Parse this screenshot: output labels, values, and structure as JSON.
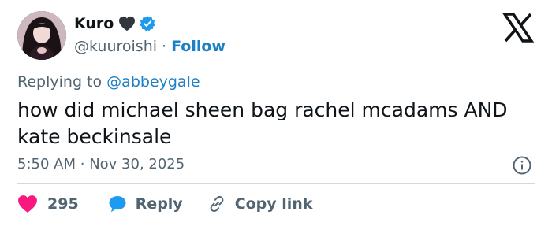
{
  "author": {
    "name": "Kuro",
    "handle": "@kuuroishi",
    "separator": "·",
    "follow_label": "Follow",
    "name_emoji_icon": "black-heart-icon",
    "verified_icon": "verified-badge-icon",
    "avatar_icon": "profile-photo"
  },
  "brand_icon": "x-logo-icon",
  "reply_context": {
    "prefix": "Replying to",
    "mention": "@abbeygale"
  },
  "tweet": {
    "text": "how did michael sheen bag rachel mcadams AND kate beckinsale"
  },
  "meta": {
    "time": "5:50 AM",
    "separator": "·",
    "date": "Nov 30, 2025",
    "info_icon": "info-icon"
  },
  "actions": {
    "like_count": "295",
    "reply_label": "Reply",
    "copy_label": "Copy link",
    "like_icon": "heart-icon",
    "reply_icon": "speech-bubble-icon",
    "copy_icon": "link-icon"
  },
  "colors": {
    "text": "#0f1419",
    "muted": "#536471",
    "link": "#1d7fc4",
    "like": "#f91880",
    "reply": "#1d9bf0",
    "divider": "#cfd9de"
  }
}
